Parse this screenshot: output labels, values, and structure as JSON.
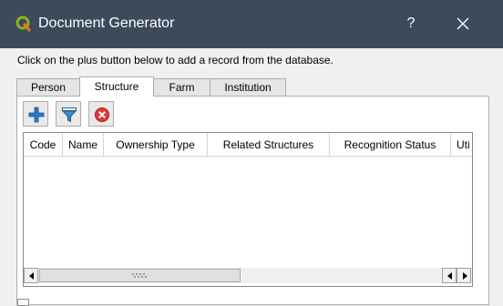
{
  "window": {
    "title": "Document Generator",
    "help_label": "?"
  },
  "instruction": "Click on the plus button below to add a record from the database.",
  "tabs": [
    {
      "label": "Person",
      "active": false
    },
    {
      "label": "Structure",
      "active": true
    },
    {
      "label": "Farm",
      "active": false
    },
    {
      "label": "Institution",
      "active": false
    }
  ],
  "toolbar": {
    "add": "add-icon",
    "filter": "filter-icon",
    "remove": "remove-icon"
  },
  "table": {
    "columns": [
      "Code",
      "Name",
      "Ownership Type",
      "Related Structures",
      "Recognition Status",
      "Uti"
    ],
    "rows": []
  },
  "colors": {
    "titlebar": "#3c4a5b",
    "add_icon": "#2f77c9",
    "filter_icon": "#3a8fc7",
    "remove_icon": "#e03a3a"
  }
}
